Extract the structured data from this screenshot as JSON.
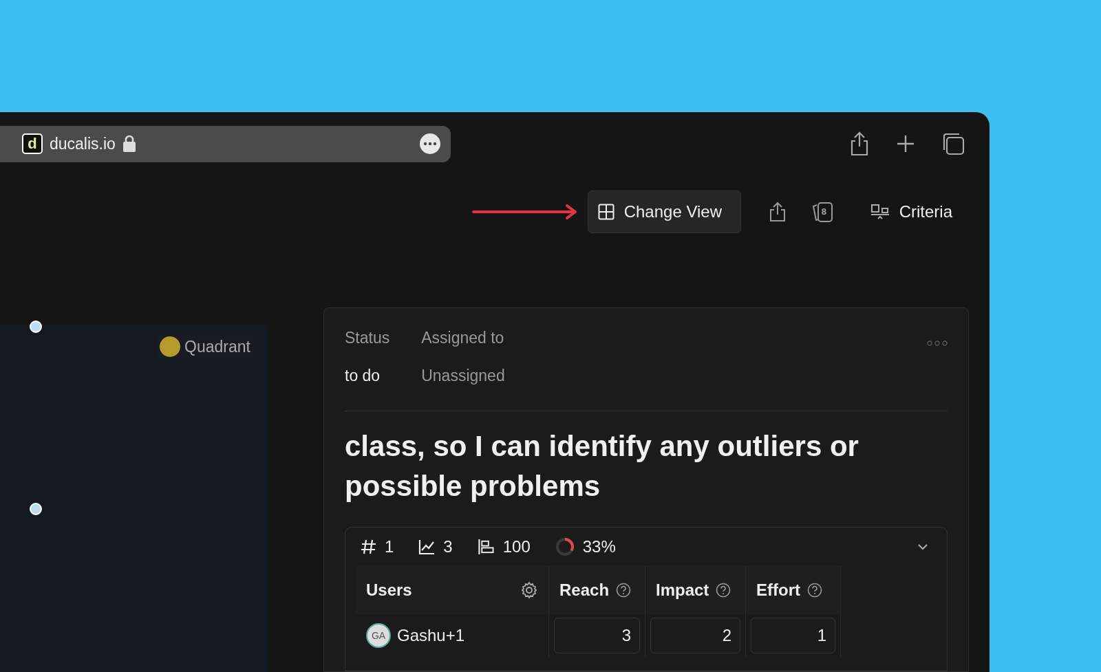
{
  "browser": {
    "favicon": "d",
    "url": "ducalis.io",
    "secure": true
  },
  "toolbar": {
    "buttons": [
      {
        "kind": "change-view",
        "label": "Change View",
        "highlighted": true
      },
      {
        "kind": "share"
      },
      {
        "kind": "cards",
        "badge": "8"
      },
      {
        "kind": "criteria",
        "label": "Criteria"
      }
    ]
  },
  "canvas": {
    "quadrant": {
      "label": "Quadrant",
      "color": "#b59a2c"
    }
  },
  "card": {
    "fields": [
      {
        "label": "Status",
        "value": "to do",
        "muted": false
      },
      {
        "label": "Assigned to",
        "value": "Unassigned",
        "muted": true
      }
    ],
    "title": "class, so I can identify any outliers or possible problems",
    "stats": [
      {
        "kind": "rank",
        "value": "1"
      },
      {
        "kind": "trend",
        "value": "3"
      },
      {
        "kind": "score",
        "value": "100"
      },
      {
        "kind": "progress",
        "value": "33%",
        "level": 0.33
      }
    ],
    "table": {
      "columns": [
        {
          "kind": "users",
          "label": "Users"
        },
        {
          "kind": "criterion",
          "label": "Reach"
        },
        {
          "kind": "criterion",
          "label": "Impact"
        },
        {
          "kind": "criterion",
          "label": "Effort"
        }
      ],
      "rows": [
        {
          "cells": [
            {
              "kind": "user",
              "initials": "GA",
              "text": "Gashu+1"
            },
            {
              "kind": "score",
              "text": "3"
            },
            {
              "kind": "score",
              "text": "2"
            },
            {
              "kind": "score",
              "text": "1"
            }
          ]
        }
      ]
    }
  }
}
